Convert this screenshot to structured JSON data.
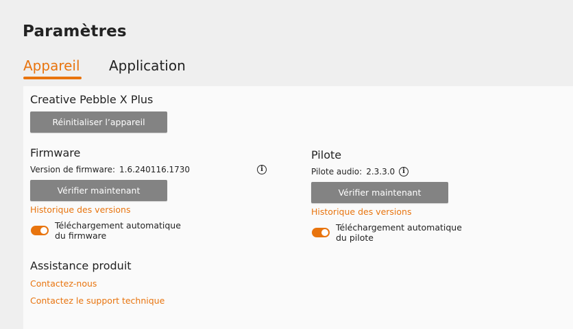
{
  "page_title": "Paramètres",
  "tabs": [
    {
      "label": "Appareil",
      "active": true
    },
    {
      "label": "Application",
      "active": false
    }
  ],
  "device": {
    "name": "Creative Pebble X Plus",
    "reset_button": "Réinitialiser l’appareil"
  },
  "firmware": {
    "title": "Firmware",
    "version_label": "Version de firmware:",
    "version_value": "1.6.240116.1730",
    "check_button": "Vérifier maintenant",
    "history_link": "Historique des versions",
    "auto_download_line1": "Téléchargement automatique",
    "auto_download_line2": "du firmware",
    "auto_download_enabled": true
  },
  "driver": {
    "title": "Pilote",
    "version_label": "Pilote audio:",
    "version_value": "2.3.3.0",
    "check_button": "Vérifier maintenant",
    "history_link": "Historique des versions",
    "auto_download_line1": "Téléchargement automatique",
    "auto_download_line2": "du pilote",
    "auto_download_enabled": true
  },
  "support": {
    "title": "Assistance produit",
    "contact_link": "Contactez-nous",
    "tech_support_link": "Contactez le support technique"
  },
  "colors": {
    "accent": "#e8740e",
    "button_bg": "#838383",
    "panel_bg": "#fafafa",
    "page_bg": "#efefef"
  },
  "icons": {
    "info": "info-icon"
  }
}
